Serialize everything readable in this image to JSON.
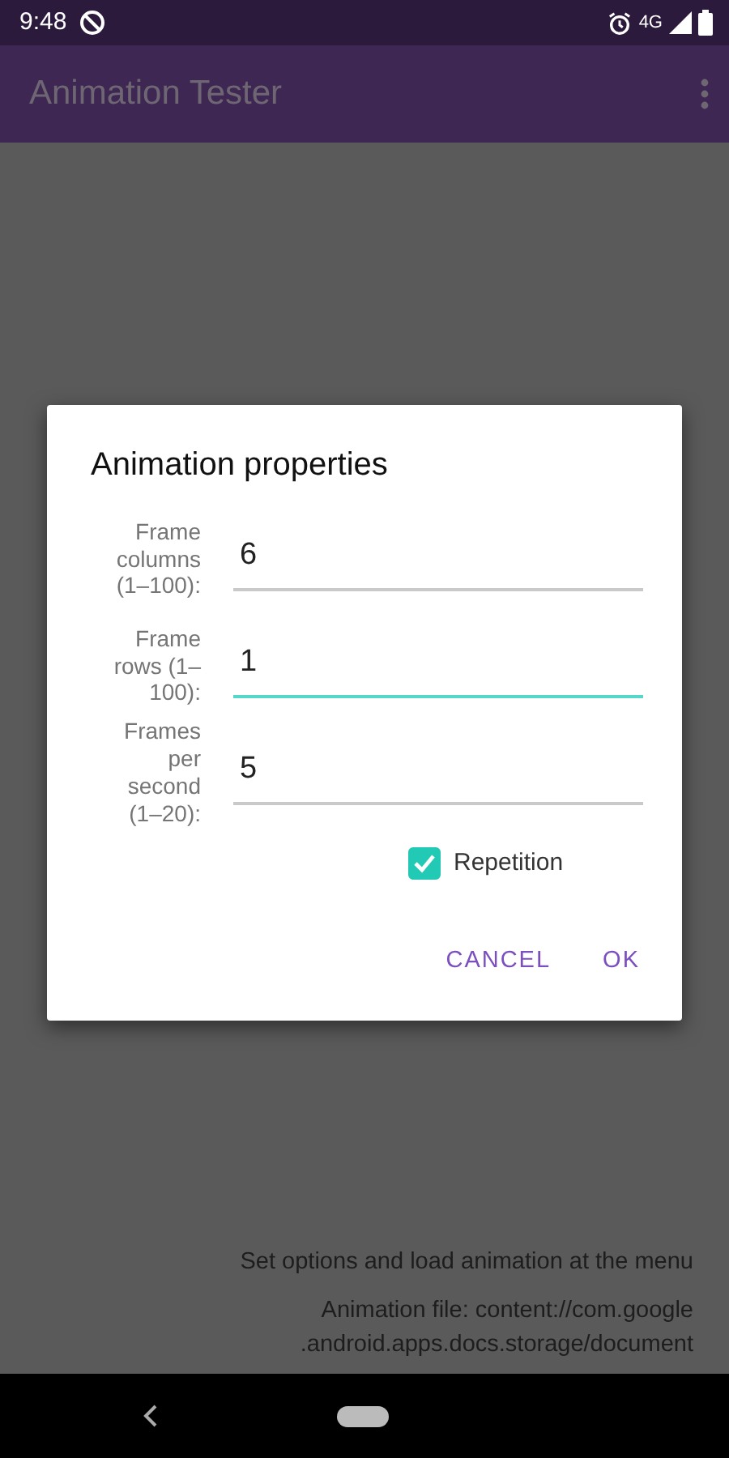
{
  "status_bar": {
    "time": "9:48",
    "network": "4G"
  },
  "app_bar": {
    "title": "Animation Tester"
  },
  "background": {
    "hint": "Set options and load animation at the menu",
    "file_line_1": "Animation file:  content://com.google",
    "file_line_2": ".android.apps.docs.storage/document"
  },
  "dialog": {
    "title": "Animation properties",
    "fields": [
      {
        "label": "Frame columns (1–100):",
        "value": "6",
        "focused": false
      },
      {
        "label": "Frame rows (1–100):",
        "value": "1",
        "focused": true
      },
      {
        "label": "Frames per second (1–20):",
        "value": "5",
        "focused": false
      }
    ],
    "checkbox": {
      "label": "Repetition",
      "checked": true
    },
    "buttons": [
      "CANCEL",
      "OK"
    ]
  }
}
